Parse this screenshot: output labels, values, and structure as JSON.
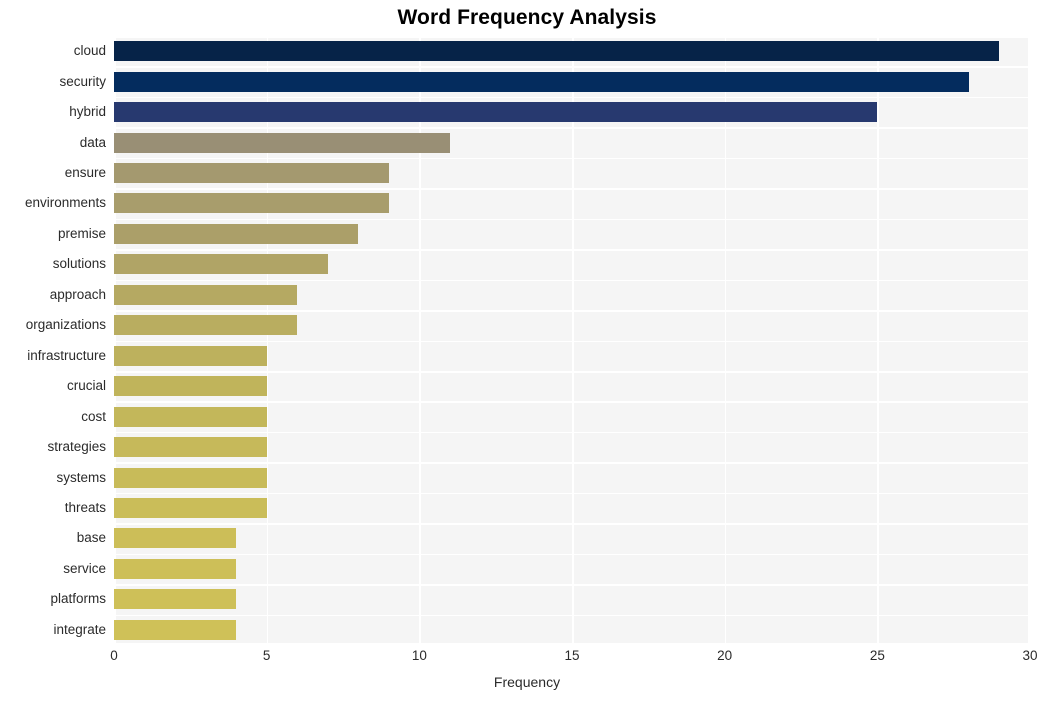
{
  "chart_data": {
    "type": "bar",
    "orientation": "horizontal",
    "title": "Word Frequency Analysis",
    "xlabel": "Frequency",
    "ylabel": "",
    "xlim": [
      0,
      30
    ],
    "xticks": [
      0,
      5,
      10,
      15,
      20,
      25,
      30
    ],
    "xtick_labels": [
      "0",
      "5",
      "10",
      "15",
      "20",
      "25",
      "30"
    ],
    "grid": true,
    "legend": null,
    "categories": [
      "cloud",
      "security",
      "hybrid",
      "data",
      "ensure",
      "environments",
      "premise",
      "solutions",
      "approach",
      "organizations",
      "infrastructure",
      "crucial",
      "cost",
      "strategies",
      "systems",
      "threats",
      "base",
      "service",
      "platforms",
      "integrate"
    ],
    "values": [
      29,
      28,
      25,
      11,
      9,
      9,
      8,
      7,
      6,
      6,
      5,
      5,
      5,
      5,
      5,
      5,
      4,
      4,
      4,
      4
    ],
    "bar_colors": [
      "#062348",
      "#042c5e",
      "#27396f",
      "#998f75",
      "#a4996f",
      "#a89d6c",
      "#ab9f69",
      "#b0a466",
      "#b5a962",
      "#b9ad60",
      "#bdb15d",
      "#c0b45b",
      "#c3b75a",
      "#c6b95a",
      "#c8bb59",
      "#cabd59",
      "#ccbe58",
      "#cdbf58",
      "#cec058",
      "#cfc158"
    ],
    "plot_background": "#f5f5f5",
    "gridline_color": "#ffffff",
    "page_background": "#ffffff",
    "text_color": "#2b2b2b",
    "title_color": "#000000"
  }
}
